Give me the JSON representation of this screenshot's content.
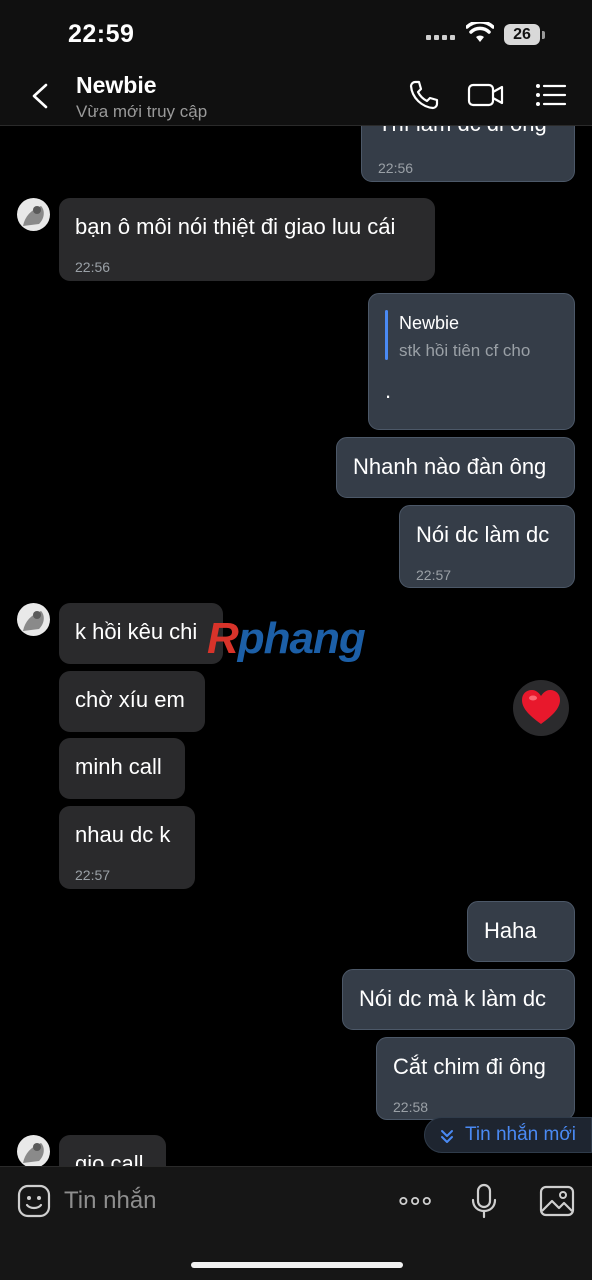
{
  "status_bar": {
    "time": "22:59",
    "battery": "26"
  },
  "header": {
    "name": "Newbie",
    "status": "Vừa mới truy cập"
  },
  "messages": [
    {
      "text": "Thì làm dc đi ông",
      "time": "22:56"
    },
    {
      "text": "bạn ô môi nói thiệt đi giao luu cái",
      "time": "22:56"
    },
    {
      "quote_name": "Newbie",
      "quote_text": "stk hồi tiên cf cho",
      "text": "."
    },
    {
      "text": "Nhanh nào đàn ông"
    },
    {
      "text": "Nói dc làm dc",
      "time": "22:57"
    },
    {
      "text": "k hồi kêu chi"
    },
    {
      "text": "chờ xíu em"
    },
    {
      "text": "minh call"
    },
    {
      "text": "nhau dc k",
      "time": "22:57"
    },
    {
      "text": "Haha"
    },
    {
      "text": "Nói dc mà k làm dc"
    },
    {
      "text": "Cắt chim đi ông",
      "time": "22:58"
    },
    {
      "text": "gio call"
    }
  ],
  "watermark": {
    "r": "R",
    "rest": "phang"
  },
  "new_message_label": "Tin nhắn mới",
  "input": {
    "placeholder": "Tin nhắn"
  },
  "colors": {
    "outgoing_bubble": "#353d48",
    "incoming_bubble": "#2a2a2c",
    "accent": "#4a8af4",
    "reaction": "#e8182c"
  },
  "icons": [
    "back-icon",
    "phone-icon",
    "video-call-icon",
    "menu-list-icon",
    "heart-icon",
    "chevron-double-down-icon",
    "sticker-icon",
    "more-icon",
    "microphone-icon",
    "image-icon"
  ]
}
